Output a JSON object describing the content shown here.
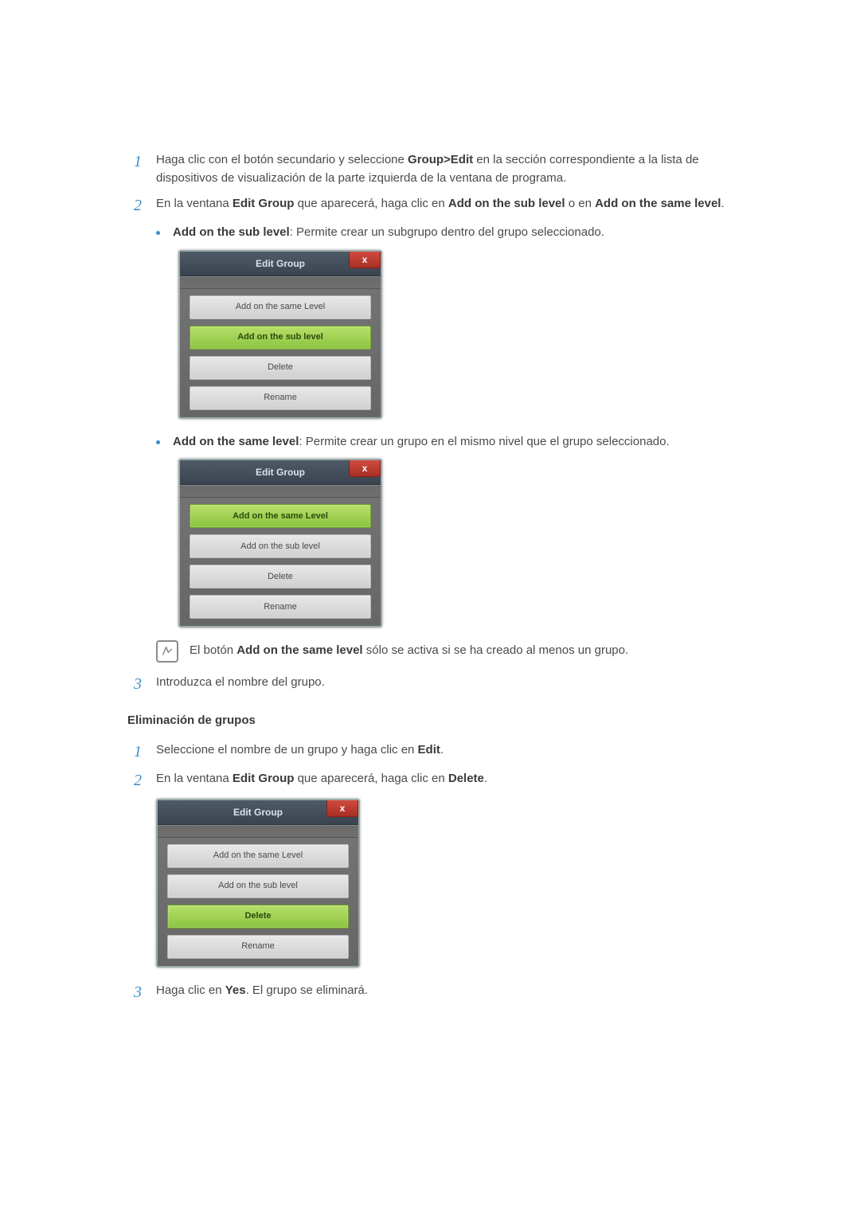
{
  "creation": {
    "step1": {
      "num": "1",
      "pre": "Haga clic con el botón secundario y seleccione ",
      "bold1": "Group>Edit",
      "post1": " en la sección correspondiente a la lista de dispositivos de visualización de la parte izquierda de la ventana de programa."
    },
    "step2": {
      "num": "2",
      "pre": "En la ventana ",
      "bold1": "Edit Group",
      "mid1": " que aparecerá, haga clic en ",
      "bold2": "Add on the sub level",
      "mid2": " o en ",
      "bold3": "Add on the same level",
      "post": "."
    },
    "bullet_sub": {
      "label": "Add on the sub level",
      "desc": ": Permite crear un subgrupo dentro del grupo seleccionado."
    },
    "bullet_same": {
      "label": "Add on the same level",
      "desc": ": Permite crear un grupo en el mismo nivel que el grupo seleccionado."
    },
    "note": {
      "pre": "El botón ",
      "bold": "Add on the same level",
      "post": " sólo se activa si se ha creado al menos un grupo."
    },
    "step3": {
      "num": "3",
      "text": "Introduzca el nombre del grupo."
    }
  },
  "dialog": {
    "title": "Edit Group",
    "close": "x",
    "btn_same": "Add on the same Level",
    "btn_sub": "Add on the sub level",
    "btn_delete": "Delete",
    "btn_rename": "Rename"
  },
  "deletion": {
    "heading": "Eliminación de grupos",
    "step1": {
      "num": "1",
      "pre": "Seleccione el nombre de un grupo y haga clic en ",
      "bold": "Edit",
      "post": "."
    },
    "step2": {
      "num": "2",
      "pre": "En la ventana ",
      "bold1": "Edit Group",
      "mid": " que aparecerá, haga clic en ",
      "bold2": "Delete",
      "post": "."
    },
    "step3": {
      "num": "3",
      "pre": "Haga clic en ",
      "bold": "Yes",
      "post": ". El grupo se eliminará."
    }
  }
}
